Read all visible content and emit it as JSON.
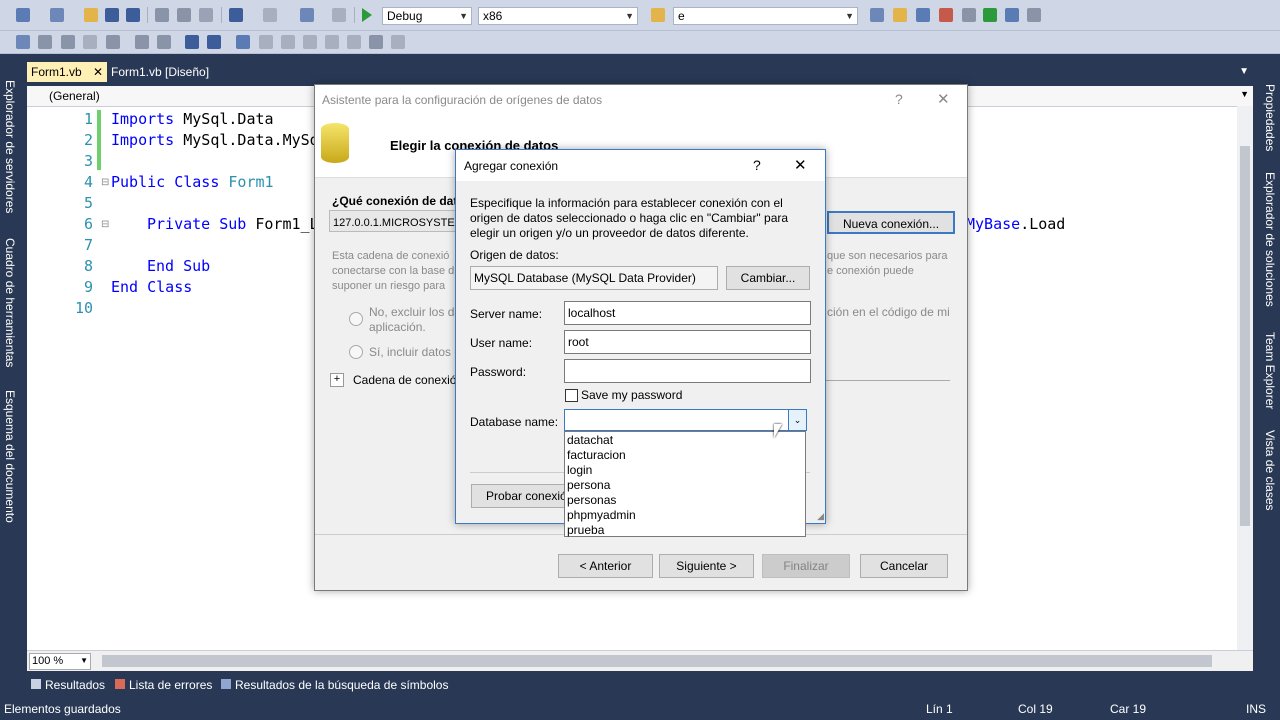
{
  "toolbar": {
    "config_combo": "Debug",
    "platform_combo": "x86",
    "find_combo": "e"
  },
  "tabs": [
    {
      "label": "Form1.vb",
      "close": "✕"
    },
    {
      "label": "Form1.vb [Diseño]"
    }
  ],
  "left_sidebar": [
    "Explorador de servidores",
    "Cuadro de herramientas",
    "Esquema del documento"
  ],
  "right_sidebar": [
    "Propiedades",
    "Explorador de soluciones",
    "Team Explorer",
    "Vista de clases"
  ],
  "editor": {
    "scope_combo": "(General)",
    "line_numbers": [
      "1",
      "2",
      "3",
      "4",
      "5",
      "6",
      "7",
      "8",
      "9",
      "10"
    ],
    "code": {
      "l1_kw": "Imports",
      "l1_rest": " MySql.Data",
      "l2_kw": "Imports",
      "l2_rest": " MySql.Data.MySq",
      "l4_kw": "Public Class",
      "l4_rest": " Form1",
      "l6_kw": "Private Sub",
      "l6_rest": " Form1_L",
      "l6_tail_ty": "MyBase",
      "l6_tail_rest": ".Load",
      "l8_kw": "End Sub",
      "l9_kw": "End Class"
    },
    "zoom": "100 %"
  },
  "wizard": {
    "title": "Asistente para la configuración de orígenes de datos",
    "help": "?",
    "close": "✕",
    "heading": "Elegir la conexión de datos",
    "question": "¿Qué conexión de dato",
    "connection_value": "127.0.0.1.MICROSYSTER",
    "new_connection_button": "Nueva conexión...",
    "info_left_1": "Esta cadena de conexió",
    "info_left_2": "conectarse con la base d",
    "info_left_3": "suponer un riesgo para",
    "info_right_1": "que son necesarios para",
    "info_right_2": "e conexión puede",
    "radio_no_1": "No, excluir los da",
    "radio_no_2": "aplicación.",
    "radio_no_right": "ción en el código de mi",
    "radio_yes": "Sí, incluir datos c",
    "expander": "Cadena de conexión",
    "expander_icon": "+",
    "back_button": "< Anterior",
    "next_button": "Siguiente >",
    "finish_button": "Finalizar",
    "cancel_button": "Cancelar"
  },
  "add_connection": {
    "title": "Agregar conexión",
    "help": "?",
    "close": "✕",
    "description_1": "Especifique la información para establecer conexión con el",
    "description_2": "origen de datos seleccionado o haga clic en \"Cambiar\" para",
    "description_3": "elegir un origen y/o un proveedor de datos diferente.",
    "source_label": "Origen de datos:",
    "source_value": "MySQL Database (MySQL Data Provider)",
    "change_button": "Cambiar...",
    "server_label": "Server name:",
    "server_value": "localhost",
    "user_label": "User name:",
    "user_value": "root",
    "password_label": "Password:",
    "password_value": "",
    "save_password_label": "Save my password",
    "save_password_checked": false,
    "database_label": "Database name:",
    "database_value": "",
    "database_options": [
      "datachat",
      "facturacion",
      "login",
      "persona",
      "personas",
      "phpmyadmin",
      "prueba"
    ],
    "test_button": "Probar conexió"
  },
  "bottom_tabs": [
    "Resultados",
    "Lista de errores",
    "Resultados de la búsqueda de símbolos"
  ],
  "status": {
    "message": "Elementos guardados",
    "line": "Lín 1",
    "col": "Col 19",
    "car": "Car 19",
    "mode": "INS"
  }
}
